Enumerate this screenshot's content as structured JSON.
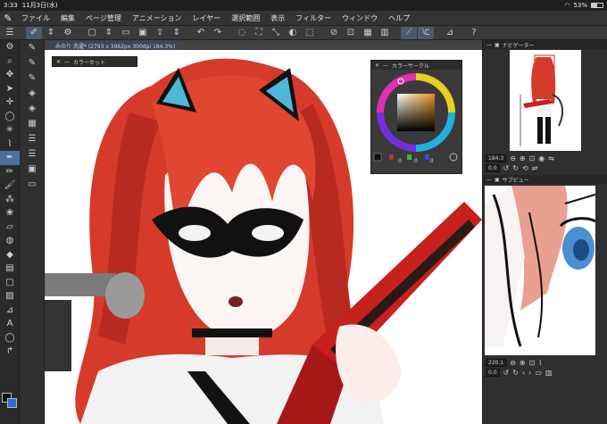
{
  "status": {
    "time": "3:33",
    "date": "11月3日(水)",
    "battery": "53%"
  },
  "menu": [
    "ファイル",
    "編集",
    "ページ管理",
    "アニメーション",
    "レイヤー",
    "選択範囲",
    "表示",
    "フィルター",
    "ウィンドウ",
    "ヘルプ"
  ],
  "document": {
    "tab_label": "みのり  洗濯* (2793 x 3962px 300dpi 184.3%)"
  },
  "panels": {
    "color_set": {
      "title": "カラーセット"
    },
    "color_circle": {
      "title": "カラーサークル",
      "rgb_values": [
        "0",
        "0",
        "0"
      ]
    },
    "navigator": {
      "title": "ナビゲーター",
      "zoom": "184.3",
      "rotation": "0.0"
    },
    "sub_view": {
      "title": "サブビュー",
      "zoom": "220.1",
      "rotation": "0.0"
    }
  },
  "colors": {
    "accent": "#4a6fa0",
    "hair": "#d63a2b",
    "guitar": "#c81f1f",
    "main_color": "#111111",
    "sub_color": "#2f6bd6"
  }
}
